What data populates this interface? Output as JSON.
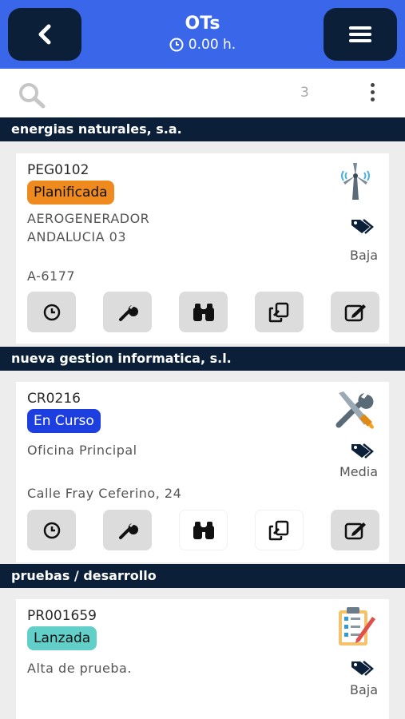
{
  "header": {
    "title": "OTs",
    "hours": "0.00 h."
  },
  "search": {
    "count": "3"
  },
  "groups": [
    {
      "name": "energias naturales, s.a.",
      "card": {
        "code": "PEG0102",
        "status": "Planificada",
        "status_color": "#ee8a1e",
        "description_line1": "AEROGENERADOR",
        "description_line2": "ANDALUCIA 03",
        "priority": "Baja",
        "address": "A-6177",
        "type_icon": "wind-turbine-icon"
      }
    },
    {
      "name": "nueva gestion informatica, s.l.",
      "card": {
        "code": "CR0216",
        "status": "En Curso",
        "status_color": "#1d3fe0",
        "description_line1": "Oficina Principal",
        "description_line2": "",
        "priority": "Media",
        "address": "Calle Fray Ceferino, 24",
        "type_icon": "tools-icon"
      }
    },
    {
      "name": "pruebas / desarrollo",
      "card": {
        "code": "PR001659",
        "status": "Lanzada",
        "status_color": "#63cfc9",
        "description_line1": "Alta de prueba.",
        "description_line2": "",
        "priority": "Baja",
        "address": "",
        "type_icon": "clipboard-checklist-icon"
      }
    }
  ]
}
